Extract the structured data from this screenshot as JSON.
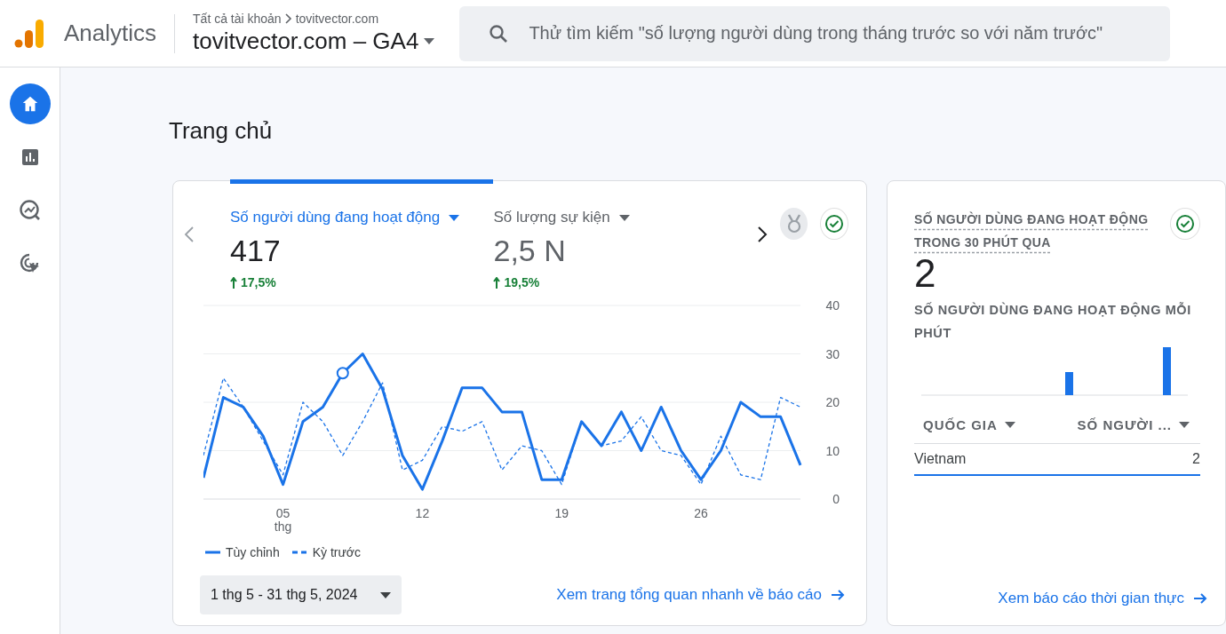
{
  "header": {
    "product": "Analytics",
    "breadcrumb": [
      "Tất cả tài khoản",
      "tovitvector.com"
    ],
    "property": "tovitvector.com – GA4",
    "search": {
      "placeholder": "Thử tìm kiếm \"số lượng người dùng trong tháng trước so với năm trước\""
    }
  },
  "sidebar": {
    "items": [
      {
        "kind": "home",
        "selected": true
      },
      {
        "kind": "reports",
        "selected": false
      },
      {
        "kind": "explore",
        "selected": false
      },
      {
        "kind": "advertising",
        "selected": false
      }
    ]
  },
  "page_title": "Trang chủ",
  "overview": {
    "metrics": [
      {
        "label": "Số người dùng đang hoạt động",
        "value": "417",
        "change": "17,5%",
        "selected": true
      },
      {
        "label": "Số lượng sự kiện",
        "value": "2,5 N",
        "change": "19,5%",
        "selected": false
      }
    ],
    "chart_data": {
      "type": "line",
      "x": [
        1,
        2,
        3,
        4,
        5,
        6,
        7,
        8,
        9,
        10,
        11,
        12,
        13,
        14,
        15,
        16,
        17,
        18,
        19,
        20,
        21,
        22,
        23,
        24,
        25,
        26,
        27,
        28,
        29,
        30,
        31
      ],
      "xlim": [
        1,
        31
      ],
      "ylim": [
        0,
        40
      ],
      "grid": true,
      "xticks": [
        {
          "value": 5,
          "label": "05"
        },
        {
          "value": 12,
          "label": "12"
        },
        {
          "value": 19,
          "label": "19"
        },
        {
          "value": 26,
          "label": "26"
        }
      ],
      "yticks": [
        0,
        10,
        20,
        30,
        40
      ],
      "series": [
        {
          "name": "Tùy chỉnh",
          "color": "#1a73e8",
          "line_style": "solid",
          "values": [
            4.4,
            21,
            19,
            13,
            3,
            16,
            19,
            26,
            30,
            22.7,
            9,
            2,
            12,
            23,
            23,
            18,
            18,
            4,
            4,
            16,
            11,
            18,
            10,
            19,
            10,
            4,
            10,
            20,
            17,
            17,
            7
          ]
        },
        {
          "name": "Kỳ trước",
          "color": "#1a73e8",
          "line_style": "dashed",
          "values": [
            9,
            25,
            19,
            12,
            5,
            20,
            16,
            9,
            16,
            24,
            6,
            8,
            15,
            14,
            16,
            6,
            11,
            10,
            3,
            16,
            11,
            12,
            17,
            10,
            9,
            3,
            13,
            5,
            4,
            21,
            19
          ]
        }
      ]
    },
    "month_label": "thg",
    "date_range": "1 thg 5 - 31 thg 5, 2024",
    "link": "Xem trang tổng quan nhanh về báo cáo"
  },
  "realtime": {
    "title": "SỐ NGƯỜI DÙNG ĐANG HOẠT ĐỘNG TRONG 30 PHÚT QUA",
    "value": "2",
    "subtitle": "SỐ NGƯỜI DÙNG ĐANG HOẠT ĐỘNG MỖI PHÚT",
    "table": {
      "columns": [
        "QUỐC GIA",
        "SỐ NGƯỜI ..."
      ],
      "rows": [
        {
          "country": "Vietnam",
          "users": "2"
        }
      ]
    },
    "link": "Xem báo cáo thời gian thực"
  }
}
